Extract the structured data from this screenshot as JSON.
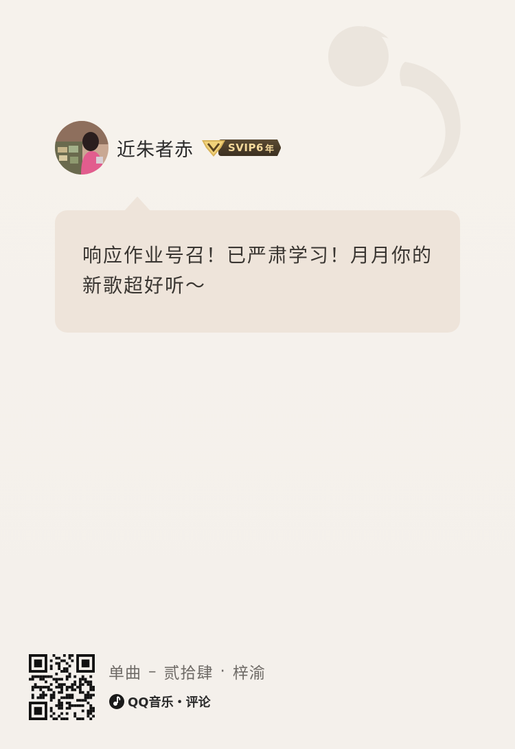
{
  "user": {
    "name": "近朱者赤",
    "vip_label": "SVIP6",
    "vip_suffix": "年",
    "avatar_icon": "avatar-photo"
  },
  "comment": {
    "text": "响应作业号召！已严肃学习！月月你的新歌超好听～"
  },
  "song": {
    "type": "单曲",
    "dash": "–",
    "title": "贰拾肆",
    "dot": "·",
    "artist": "梓渝"
  },
  "brand": {
    "text": "QQ音乐・评论",
    "logo_icon": "qq-music-logo-icon",
    "qr_icon": "qr-code-icon"
  },
  "colors": {
    "background": "#f5f1ec",
    "bubble": "#eee4da",
    "vip_gold": "#f3d89a",
    "vip_dark": "#3c3021"
  }
}
